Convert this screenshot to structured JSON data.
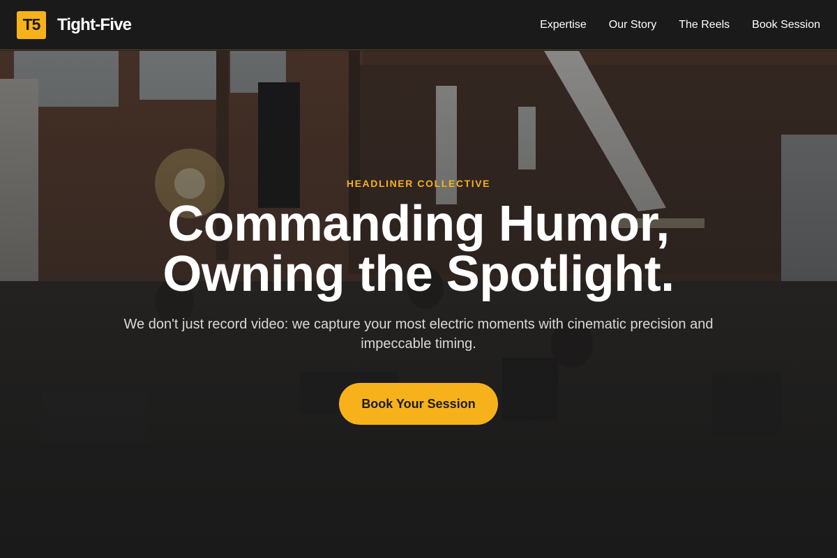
{
  "header": {
    "logo_text": "T5",
    "brand_name": "Tight-Five",
    "nav": [
      {
        "label": "Expertise"
      },
      {
        "label": "Our Story"
      },
      {
        "label": "The Reels"
      },
      {
        "label": "Book Session"
      }
    ]
  },
  "hero": {
    "eyebrow": "HEADLINER COLLECTIVE",
    "headline_line1": "Commanding Humor,",
    "headline_line2": "Owning the Spotlight.",
    "subtitle": "We don't just record video: we capture your most electric moments with cinematic precision and impeccable timing.",
    "cta_label": "Book Your Session",
    "background": "film-studio-warehouse-photo"
  },
  "colors": {
    "accent": "#f7b21b",
    "background": "#1a1a1a",
    "text": "#ffffff",
    "muted_text": "#d9d9d9"
  }
}
